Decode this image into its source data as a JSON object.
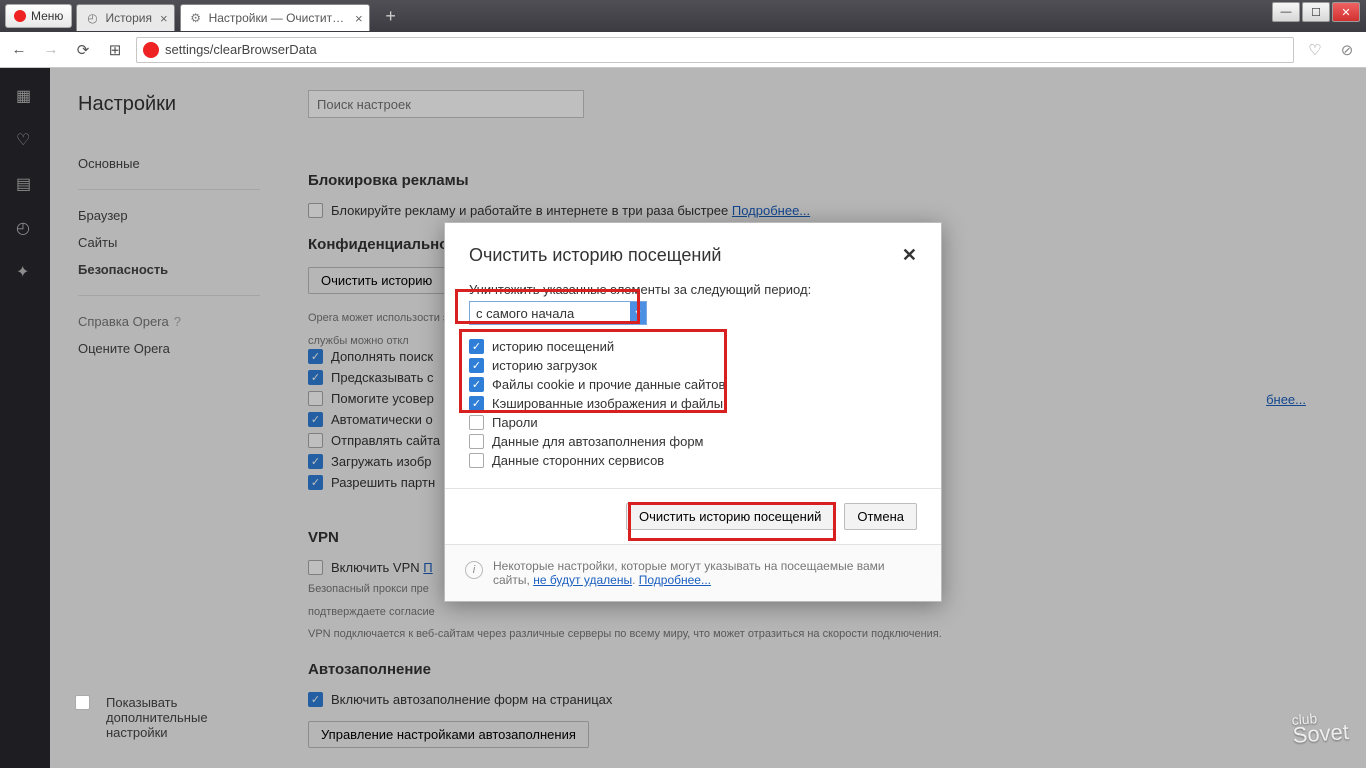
{
  "menu_label": "Меню",
  "tabs": [
    {
      "label": "История",
      "active": false
    },
    {
      "label": "Настройки — Очистить и",
      "active": true
    }
  ],
  "address": "settings/clearBrowserData",
  "settings_title": "Настройки",
  "search_placeholder": "Поиск настроек",
  "sidebar": {
    "items": [
      "Основные",
      "Браузер",
      "Сайты",
      "Безопасность"
    ],
    "active_index": 3,
    "help": "Справка Opera",
    "rate": "Оцените Opera"
  },
  "sections": {
    "adblock": {
      "title": "Блокировка рекламы",
      "text": "Блокируйте рекламу и работайте в интернете в три раза быстрее",
      "more": "Подробнее..."
    },
    "privacy": {
      "title": "Конфиденциальность",
      "clear_btn": "Очистить историю",
      "opera_note": "Opera может использ",
      "opera_note2": "службы можно откл",
      "checks": [
        "Дополнять поиск",
        "Предсказывать с",
        "Помогите усовер",
        "Автоматически о",
        "Отправлять сайта",
        "Загружать изобр",
        "Разрешить партн"
      ],
      "more": "бнее..."
    },
    "vpn": {
      "title": "VPN",
      "enable": "Включить VPN",
      "link": "П",
      "note1": "Безопасный прокси пре",
      "note2": "подтверждаете согласие",
      "note3": "VPN подключается к веб-сайтам через различные серверы по всему миру, что может отразиться на скорости подключения."
    },
    "autofill": {
      "title": "Автозаполнение",
      "enable": "Включить автозаполнение форм на страницах",
      "manage": "Управление настройками автозаполнения"
    }
  },
  "show_advanced": "Показывать дополнительные настройки",
  "dialog": {
    "title": "Очистить историю посещений",
    "period_label": "Уничтожить указанные элементы за следующий период:",
    "period_value": "с самого начала",
    "items": [
      {
        "label": "историю посещений",
        "checked": true
      },
      {
        "label": "историю загрузок",
        "checked": true
      },
      {
        "label": "Файлы cookie и прочие данные сайтов",
        "checked": true
      },
      {
        "label": "Кэшированные изображения и файлы",
        "checked": true
      },
      {
        "label": "Пароли",
        "checked": false
      },
      {
        "label": "Данные для автозаполнения форм",
        "checked": false
      },
      {
        "label": "Данные сторонних сервисов",
        "checked": false
      }
    ],
    "clear_button": "Очистить историю посещений",
    "cancel_button": "Отмена",
    "note1": "Некоторые настройки, которые могут указывать на посещаемые вами сайты,",
    "note_link1": "не будут удалены",
    "note_link2": "Подробнее..."
  },
  "watermark": {
    "t1": "club",
    "t2": "Sovet"
  }
}
